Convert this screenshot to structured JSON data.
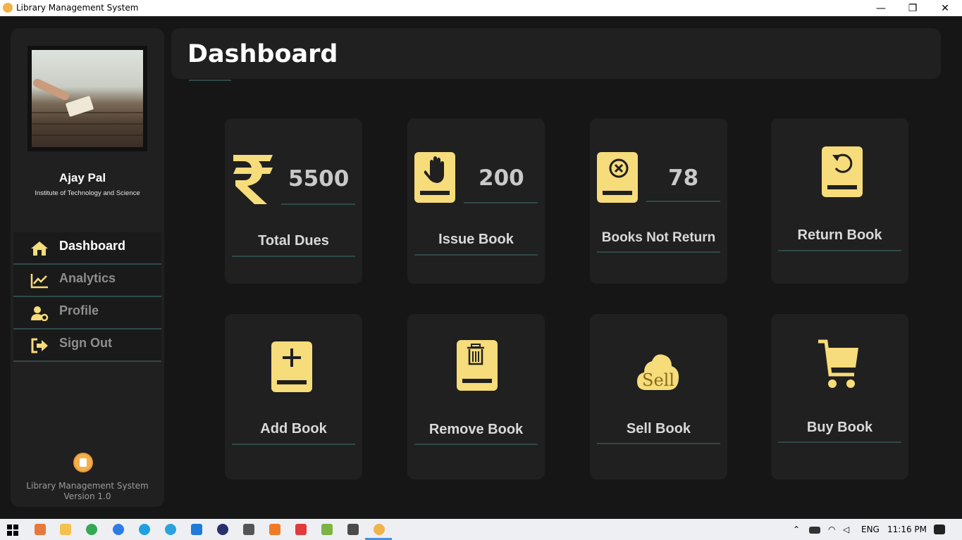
{
  "window": {
    "title": "Library Management System",
    "minimize_glyph": "—",
    "restore_glyph": "❐",
    "close_glyph": "✕"
  },
  "sidebar": {
    "user_name": "Ajay Pal",
    "institute": "Institute of Technology and Science",
    "nav": [
      {
        "label": "Dashboard",
        "icon": "home-icon",
        "active": true
      },
      {
        "label": "Analytics",
        "icon": "chart-icon",
        "active": false
      },
      {
        "label": "Profile",
        "icon": "user-gear-icon",
        "active": false
      },
      {
        "label": "Sign Out",
        "icon": "sign-out-icon",
        "active": false
      }
    ],
    "footer_line1": "Library Management System",
    "footer_line2": "Version 1.0"
  },
  "header": {
    "title": "Dashboard"
  },
  "cards": {
    "total_dues": {
      "label": "Total Dues",
      "value": "5500",
      "icon": "rupee-icon"
    },
    "issue_book": {
      "label": "Issue Book",
      "value": "200",
      "icon": "book-hand-icon"
    },
    "books_not_return": {
      "label": "Books Not Return",
      "value": "78",
      "icon": "book-x-icon"
    },
    "return_book": {
      "label": "Return Book",
      "icon": "book-return-icon"
    },
    "add_book": {
      "label": "Add Book",
      "icon": "book-plus-icon"
    },
    "remove_book": {
      "label": "Remove Book",
      "icon": "book-trash-icon"
    },
    "sell_book": {
      "label": "Sell Book",
      "icon": "sell-cloud-icon",
      "icon_text": "Sell"
    },
    "buy_book": {
      "label": "Buy Book",
      "icon": "cart-icon"
    }
  },
  "colors": {
    "accent": "#f6dc7a",
    "background": "#161616",
    "panel": "#202020",
    "underline": "#2e4a48"
  },
  "taskbar": {
    "language": "ENG",
    "time": "11:16 PM"
  }
}
